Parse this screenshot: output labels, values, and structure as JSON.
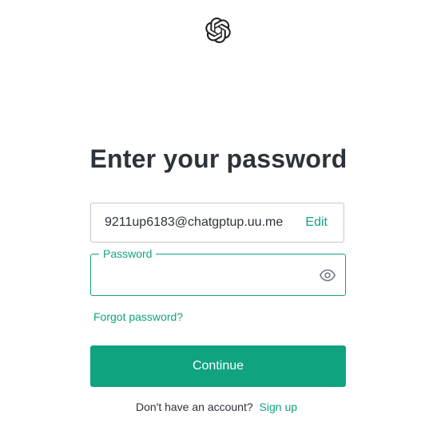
{
  "brand": {
    "logo_icon": "openai-logo-icon",
    "accent_color": "#10a37f"
  },
  "heading": {
    "title": "Enter your password"
  },
  "email_field": {
    "value": "9211up6183@chatgptup.uu.me",
    "edit_label": "Edit"
  },
  "password_field": {
    "label": "Password",
    "value": "",
    "toggle_icon": "eye-icon"
  },
  "links": {
    "forgot_password": "Forgot password?"
  },
  "actions": {
    "continue_label": "Continue"
  },
  "footer": {
    "prompt": "Don't have an account?",
    "signup_label": "Sign up"
  }
}
